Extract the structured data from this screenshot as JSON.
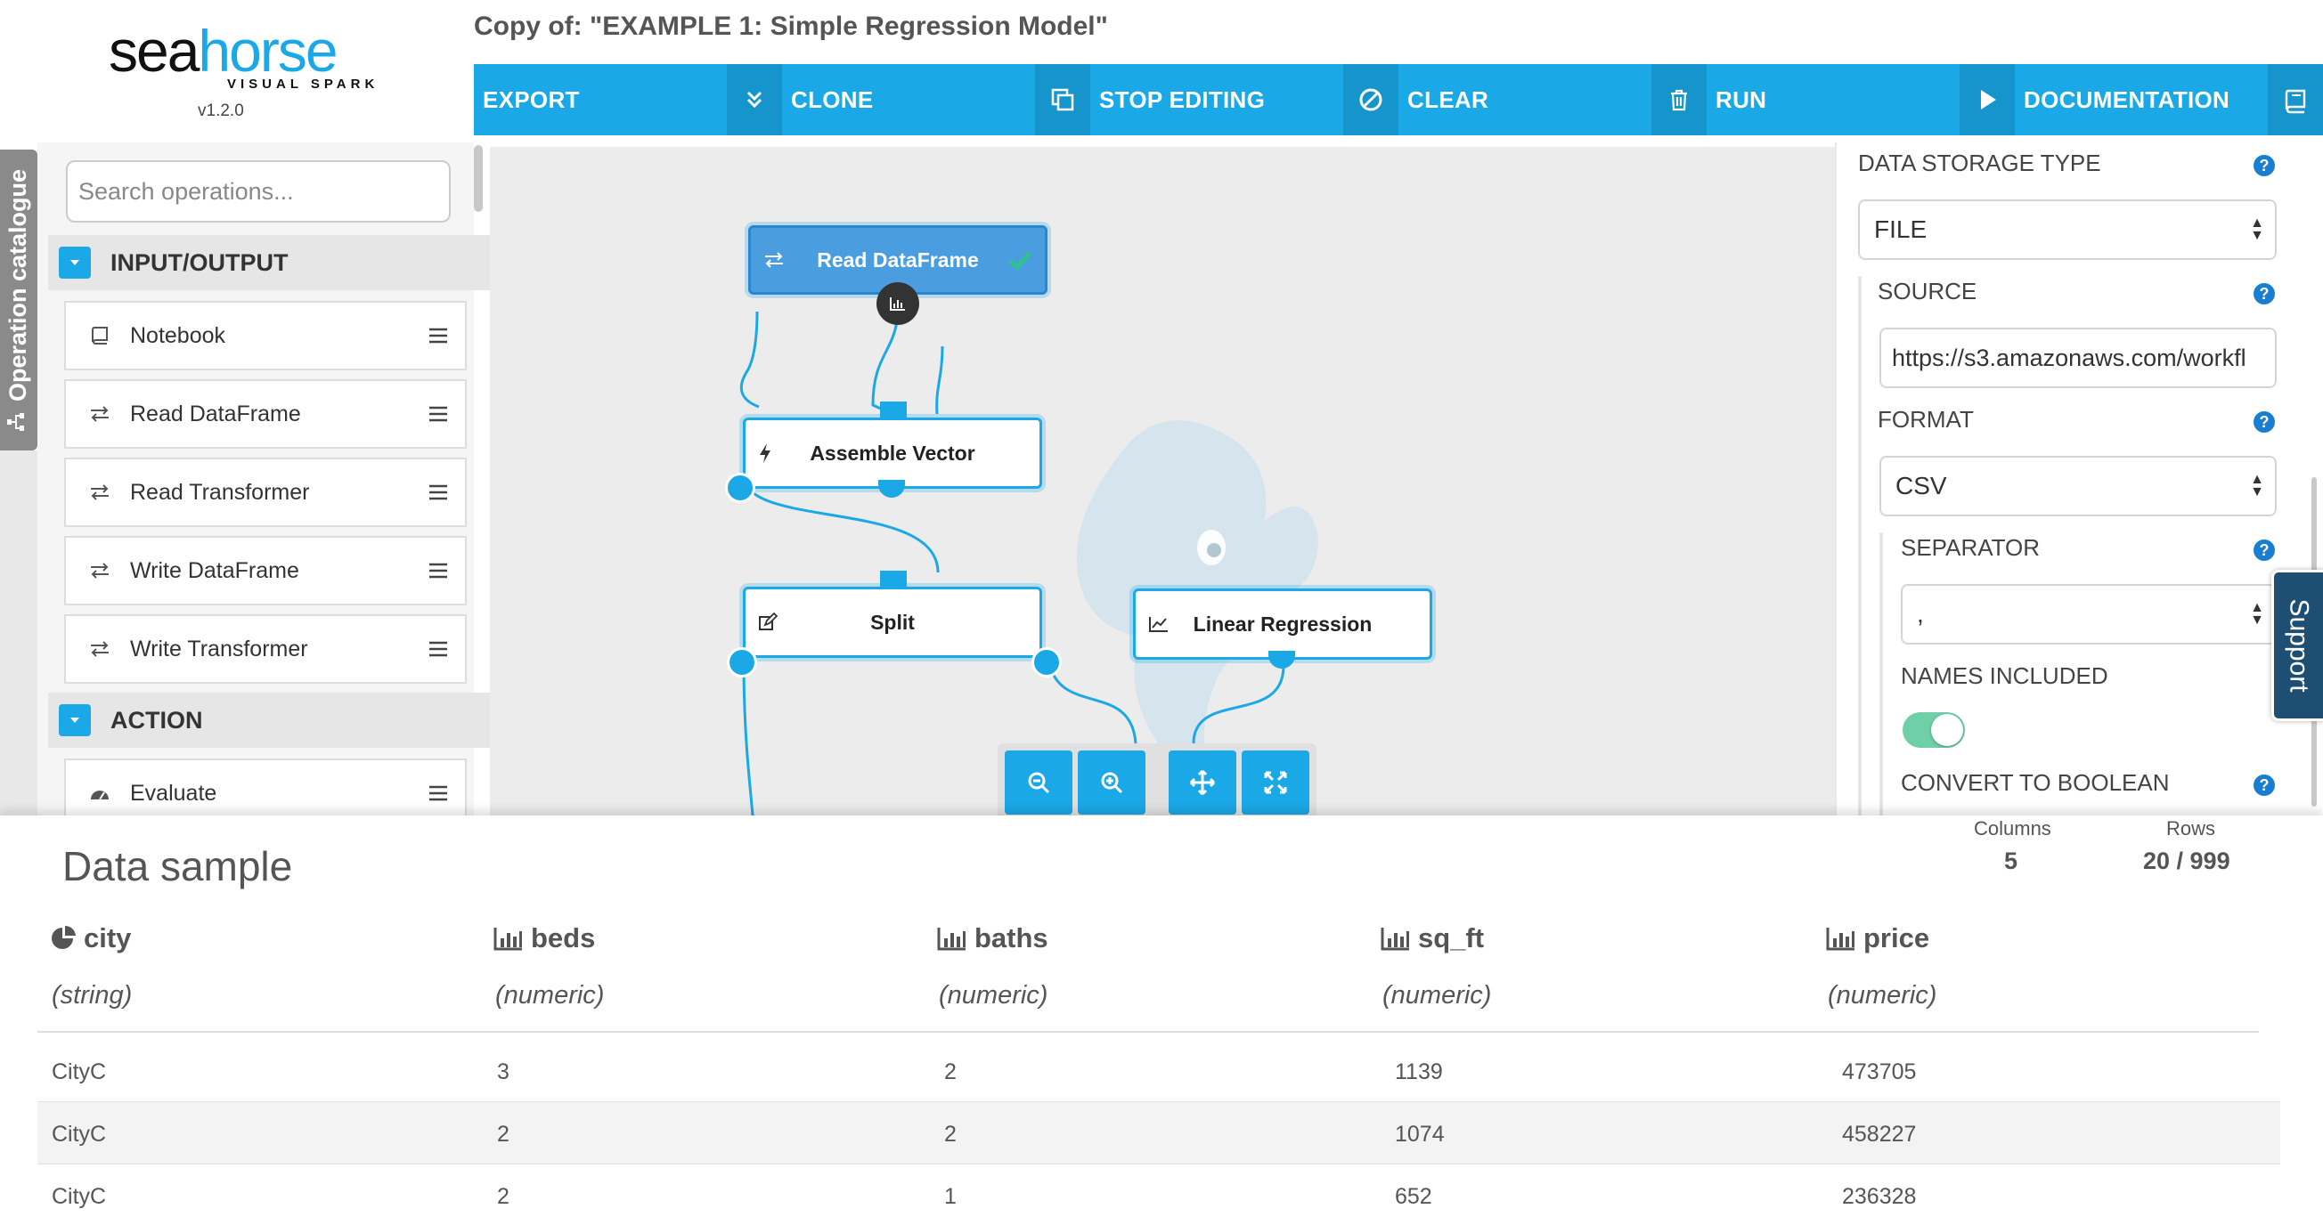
{
  "logo": {
    "brand_sea": "sea",
    "brand_horse": "horse",
    "tagline": "VISUAL SPARK",
    "version": "v1.2.0"
  },
  "title": "Copy of: \"EXAMPLE 1: Simple Regression Model\"",
  "toolbar": {
    "export": "EXPORT",
    "clone": "CLONE",
    "stop_editing": "STOP EDITING",
    "clear": "CLEAR",
    "run": "RUN",
    "documentation": "DOCUMENTATION"
  },
  "catalogue_tab": "Operation catalogue",
  "search": {
    "placeholder": "Search operations..."
  },
  "catalogue": {
    "input_output": {
      "label": "INPUT/OUTPUT",
      "items": [
        {
          "label": "Notebook",
          "icon": "book-icon"
        },
        {
          "label": "Read DataFrame",
          "icon": "exchange-icon"
        },
        {
          "label": "Read Transformer",
          "icon": "exchange-icon"
        },
        {
          "label": "Write DataFrame",
          "icon": "exchange-icon"
        },
        {
          "label": "Write Transformer",
          "icon": "exchange-icon"
        }
      ]
    },
    "action": {
      "label": "ACTION",
      "items": [
        {
          "label": "Evaluate",
          "icon": "dashboard-icon"
        }
      ]
    }
  },
  "canvas": {
    "nodes": {
      "read_dataframe": "Read DataFrame",
      "assemble_vector": "Assemble Vector",
      "split": "Split",
      "linear_regression": "Linear Regression"
    }
  },
  "properties": {
    "data_storage_type": {
      "label": "DATA STORAGE TYPE",
      "value": "FILE"
    },
    "source": {
      "label": "SOURCE",
      "value": "https://s3.amazonaws.com/workfl"
    },
    "format": {
      "label": "FORMAT",
      "value": "CSV"
    },
    "separator": {
      "label": "SEPARATOR",
      "value": ","
    },
    "names_included": {
      "label": "NAMES INCLUDED",
      "value": true
    },
    "convert_to_boolean": {
      "label": "CONVERT TO BOOLEAN"
    },
    "help": "?"
  },
  "support": "Support",
  "data_sample": {
    "title": "Data sample",
    "stats": {
      "columns_label": "Columns",
      "columns_value": "5",
      "rows_label": "Rows",
      "rows_value": "20 / 999"
    },
    "columns": [
      {
        "name": "city",
        "type": "(string)",
        "icon": "pie-chart-icon"
      },
      {
        "name": "beds",
        "type": "(numeric)",
        "icon": "bar-chart-icon"
      },
      {
        "name": "baths",
        "type": "(numeric)",
        "icon": "bar-chart-icon"
      },
      {
        "name": "sq_ft",
        "type": "(numeric)",
        "icon": "bar-chart-icon"
      },
      {
        "name": "price",
        "type": "(numeric)",
        "icon": "bar-chart-icon"
      }
    ],
    "rows": [
      [
        "CityC",
        "3",
        "2",
        "1139",
        "473705"
      ],
      [
        "CityC",
        "2",
        "2",
        "1074",
        "458227"
      ],
      [
        "CityC",
        "2",
        "1",
        "652",
        "236328"
      ]
    ]
  },
  "colors": {
    "accent": "#1aa8e6",
    "accent_dark": "#1595cc",
    "toggle_on": "#6fcfa7",
    "support": "#1e4f73"
  }
}
